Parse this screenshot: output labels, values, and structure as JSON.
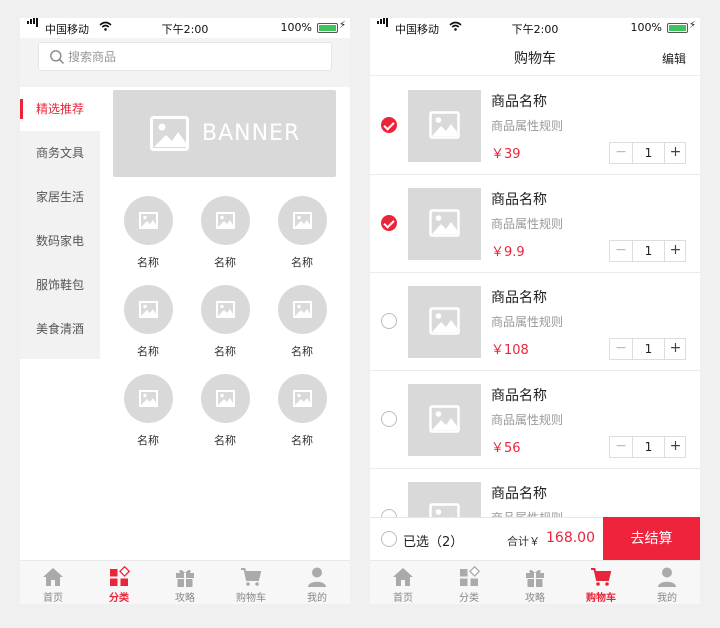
{
  "colors": {
    "accent": "#e9253b",
    "placeholder_gray": "#d9d9d9",
    "page_bg": "#f0f0f0"
  },
  "status_bar": {
    "carrier": "中国移动",
    "time": "下午2:00",
    "battery": "100%"
  },
  "category_page": {
    "search": {
      "placeholder": "搜索商品"
    },
    "categories": [
      "精选推荐",
      "商务文具",
      "家居生活",
      "数码家电",
      "服饰鞋包",
      "美食清酒"
    ],
    "active_category": "精选推荐",
    "banner": {
      "label": "BANNER"
    },
    "subcategories": [
      "名称",
      "名称",
      "名称",
      "名称",
      "名称",
      "名称",
      "名称",
      "名称",
      "名称"
    ]
  },
  "cart_page": {
    "title": "购物车",
    "edit_label": "编辑",
    "items": [
      {
        "name": "商品名称",
        "spec": "商品属性规则",
        "price": "￥39",
        "qty": "1",
        "checked": true
      },
      {
        "name": "商品名称",
        "spec": "商品属性规则",
        "price": "￥9.9",
        "qty": "1",
        "checked": true
      },
      {
        "name": "商品名称",
        "spec": "商品属性规则",
        "price": "￥108",
        "qty": "1",
        "checked": false
      },
      {
        "name": "商品名称",
        "spec": "商品属性规则",
        "price": "￥56",
        "qty": "1",
        "checked": false
      },
      {
        "name": "商品名称",
        "spec": "商品属性规则",
        "price": "",
        "qty": "",
        "checked": false
      }
    ],
    "footer": {
      "selected_label": "已选（2）",
      "total_label": "合计￥",
      "total_value": "168.00",
      "checkout_label": "去结算"
    }
  },
  "tabbar": {
    "tabs": [
      {
        "label": "首页",
        "icon": "home-icon"
      },
      {
        "label": "分类",
        "icon": "category-icon"
      },
      {
        "label": "攻略",
        "icon": "gift-icon"
      },
      {
        "label": "购物车",
        "icon": "cart-icon"
      },
      {
        "label": "我的",
        "icon": "user-icon"
      }
    ],
    "left_active": "分类",
    "right_active": "购物车"
  }
}
